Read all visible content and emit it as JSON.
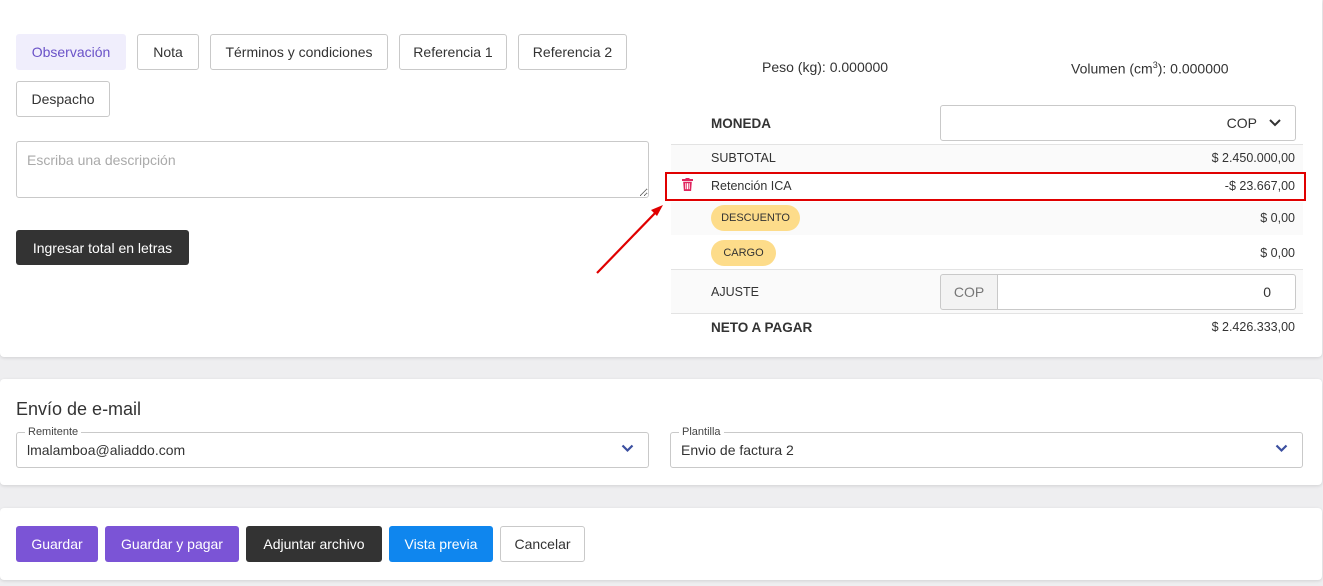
{
  "tabs": {
    "observacion": "Observación",
    "nota": "Nota",
    "terminos": "Términos y condiciones",
    "referencia1": "Referencia 1",
    "referencia2": "Referencia 2",
    "despacho": "Despacho"
  },
  "description": {
    "placeholder": "Escriba una descripción",
    "value": ""
  },
  "total_letras_button": "Ingresar total en letras",
  "meta": {
    "peso": "Peso (kg): 0.000000",
    "volumen_prefix": "Volumen (cm",
    "volumen_sup": "3",
    "volumen_suffix": "): 0.000000"
  },
  "totals": {
    "moneda_label": "MONEDA",
    "moneda_value": "COP",
    "subtotal_label": "SUBTOTAL",
    "subtotal_value": "$ 2.450.000,00",
    "retencion_label": "Retención ICA",
    "retencion_value": "-$ 23.667,00",
    "descuento_label": "DESCUENTO",
    "descuento_value": "$ 0,00",
    "cargo_label": "CARGO",
    "cargo_value": "$ 0,00",
    "ajuste_label": "AJUSTE",
    "ajuste_prefix": "COP",
    "ajuste_value": "0",
    "neto_label": "NETO A PAGAR",
    "neto_value": "$ 2.426.333,00"
  },
  "email": {
    "title": "Envío de e-mail",
    "remitente_label": "Remitente",
    "remitente_value": "lmalamboa@aliaddo.com",
    "plantilla_label": "Plantilla",
    "plantilla_value": "Envio de factura 2"
  },
  "actions": {
    "guardar": "Guardar",
    "guardar_pagar": "Guardar y pagar",
    "adjuntar": "Adjuntar archivo",
    "vista_previa": "Vista previa",
    "cancelar": "Cancelar"
  },
  "colors": {
    "primary_purple": "#7b54d6",
    "blue": "#0f86ee",
    "dark": "#333333",
    "pill_yellow": "#fddc8a",
    "highlight_red": "#e00000",
    "trash_red": "#e0245e",
    "chevron_blue": "#3b4fa0"
  },
  "icons": [
    "trash-icon",
    "chevron-down-icon",
    "annotation-arrow"
  ]
}
